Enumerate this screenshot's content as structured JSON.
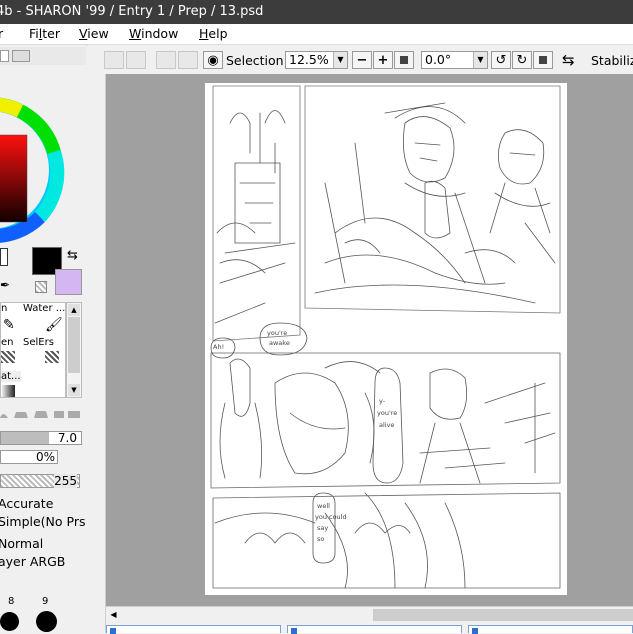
{
  "window": {
    "title": "4b - SHARON '99 / Entry 1 / Prep / 13.psd"
  },
  "menu": [
    {
      "pre": "",
      "u": "",
      "post": "r"
    },
    {
      "pre": "Fi",
      "u": "l",
      "post": "ter"
    },
    {
      "pre": "",
      "u": "V",
      "post": "iew"
    },
    {
      "pre": "",
      "u": "W",
      "post": "indow"
    },
    {
      "pre": "",
      "u": "H",
      "post": "elp"
    }
  ],
  "toolbar": {
    "selection_label": "Selection",
    "zoom_value": "12.5%",
    "rotation_value": "0.0°",
    "stabilizer_label": "Stabilize"
  },
  "tools": {
    "slot1_label": "n",
    "slot2_label": "Water ...",
    "slot3_label": "en",
    "slot4_label": "SelErs",
    "slot5_label": "at..."
  },
  "brush": {
    "size_value": "7.0",
    "density_value": "0%",
    "blend_value": "255",
    "accurate_label": "Accurate",
    "mode_label": "Simple(No Prs.)",
    "blend_mode": "Normal",
    "layer_type": "ayer ARGB",
    "size_labels": [
      "8",
      "9"
    ]
  },
  "canvas": {
    "bubble1": "you're\nawake",
    "bubble2": "Ah!",
    "bubble3": "y-\nyou're\nalive",
    "bubble4": "well\nyou could\nsay\nso"
  },
  "colors": {
    "fg": "#000000",
    "bg": "#d4b6f3",
    "accent": "#2d6fd1"
  }
}
